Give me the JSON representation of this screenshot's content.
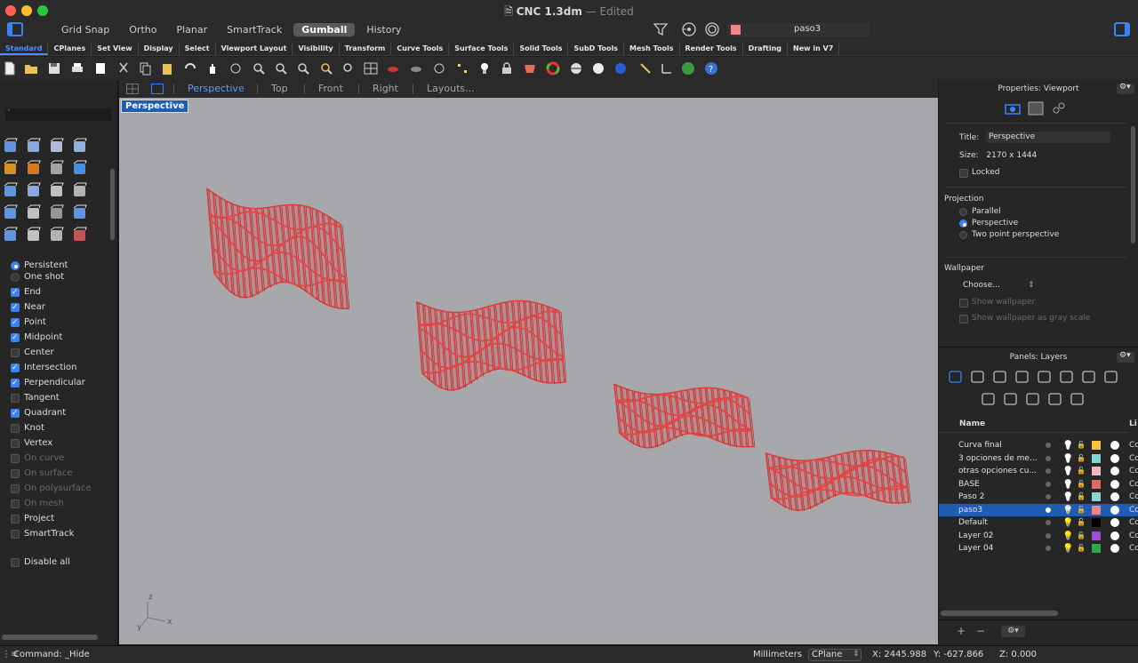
{
  "window": {
    "title": "CNC 1.3dm",
    "title_separator": "—",
    "status": "Edited",
    "colors": {
      "close": "#ff5f57",
      "minimize": "#febc2e",
      "maximize": "#28c840",
      "accent": "#3b82f6"
    }
  },
  "modes": [
    "Grid Snap",
    "Ortho",
    "Planar",
    "SmartTrack",
    "Gumball",
    "History"
  ],
  "active_mode": "Gumball",
  "current_layer": {
    "name": "paso3",
    "color": "#f08585"
  },
  "toolbar_tabs": [
    "Standard",
    "CPlanes",
    "Set View",
    "Display",
    "Select",
    "Viewport Layout",
    "Visibility",
    "Transform",
    "Curve Tools",
    "Surface Tools",
    "Solid Tools",
    "SubD Tools",
    "Mesh Tools",
    "Render Tools",
    "Drafting",
    "New in V7"
  ],
  "active_toolbar_tab": "Standard",
  "viewport_tabs": [
    "Perspective",
    "Top",
    "Front",
    "Right",
    "Layouts..."
  ],
  "active_viewport": "Perspective",
  "viewport_label": "Perspective",
  "command_input_value": "`",
  "osnap": {
    "mode_options": [
      {
        "label": "Persistent",
        "selected": true
      },
      {
        "label": "One shot",
        "selected": false
      }
    ],
    "items": [
      {
        "label": "End",
        "checked": true,
        "enabled": true
      },
      {
        "label": "Near",
        "checked": true,
        "enabled": true
      },
      {
        "label": "Point",
        "checked": true,
        "enabled": true
      },
      {
        "label": "Midpoint",
        "checked": true,
        "enabled": true
      },
      {
        "label": "Center",
        "checked": false,
        "enabled": true
      },
      {
        "label": "Intersection",
        "checked": true,
        "enabled": true
      },
      {
        "label": "Perpendicular",
        "checked": true,
        "enabled": true
      },
      {
        "label": "Tangent",
        "checked": false,
        "enabled": true
      },
      {
        "label": "Quadrant",
        "checked": true,
        "enabled": true
      },
      {
        "label": "Knot",
        "checked": false,
        "enabled": true
      },
      {
        "label": "Vertex",
        "checked": false,
        "enabled": true
      },
      {
        "label": "On curve",
        "checked": false,
        "enabled": false
      },
      {
        "label": "On surface",
        "checked": false,
        "enabled": false
      },
      {
        "label": "On polysurface",
        "checked": false,
        "enabled": false
      },
      {
        "label": "On mesh",
        "checked": false,
        "enabled": false
      },
      {
        "label": "Project",
        "checked": false,
        "enabled": true
      },
      {
        "label": "SmartTrack",
        "checked": false,
        "enabled": true
      }
    ],
    "disable_all": {
      "label": "Disable all",
      "checked": false
    }
  },
  "properties": {
    "header": "Properties: Viewport",
    "title_label": "Title:",
    "title_value": "Perspective",
    "size_label": "Size:",
    "size_value": "2170 x 1444",
    "locked_label": "Locked",
    "projection_heading": "Projection",
    "projection_options": [
      {
        "label": "Parallel",
        "selected": false
      },
      {
        "label": "Perspective",
        "selected": true
      },
      {
        "label": "Two point perspective",
        "selected": false
      }
    ],
    "wallpaper_heading": "Wallpaper",
    "wallpaper_choose": "Choose...",
    "show_wallpaper": "Show wallpaper",
    "show_wallpaper_gray": "Show wallpaper as gray scale"
  },
  "layers": {
    "header": "Panels: Layers",
    "column_name": "Name",
    "column_linetype": "Li",
    "rows": [
      {
        "name": "Curva final",
        "color": "#f5c242",
        "selected": false,
        "bulb": "white",
        "linetype": "Co"
      },
      {
        "name": "3 opciones de me...",
        "color": "#7fd8d0",
        "selected": false,
        "bulb": "white",
        "linetype": "Co"
      },
      {
        "name": "otras opciones cu...",
        "color": "#f2b8c0",
        "selected": false,
        "bulb": "white",
        "linetype": "Co"
      },
      {
        "name": "BASE",
        "color": "#e06a6a",
        "selected": false,
        "bulb": "white",
        "linetype": "Co"
      },
      {
        "name": "Paso 2",
        "color": "#8fd3c8",
        "selected": false,
        "bulb": "white",
        "linetype": "Co"
      },
      {
        "name": "paso3",
        "color": "#f08585",
        "selected": true,
        "bulb": "blue",
        "linetype": "Co"
      },
      {
        "name": "Default",
        "color": "#000000",
        "selected": false,
        "bulb": "yellow",
        "linetype": "Co"
      },
      {
        "name": "Layer 02",
        "color": "#9b4fd8",
        "selected": false,
        "bulb": "yellow",
        "linetype": "Co"
      },
      {
        "name": "Layer 04",
        "color": "#2fa84a",
        "selected": false,
        "bulb": "yellow",
        "linetype": "Co"
      }
    ],
    "add_label": "+",
    "remove_label": "−"
  },
  "axes": {
    "x": "x",
    "y": "y",
    "z": "z"
  },
  "status": {
    "command": "Command: _Hide",
    "units": "Millimeters",
    "cplane": "CPlane",
    "x": "X: 2445.988",
    "y": "Y: -627.866",
    "z": "Z: 0.000"
  }
}
